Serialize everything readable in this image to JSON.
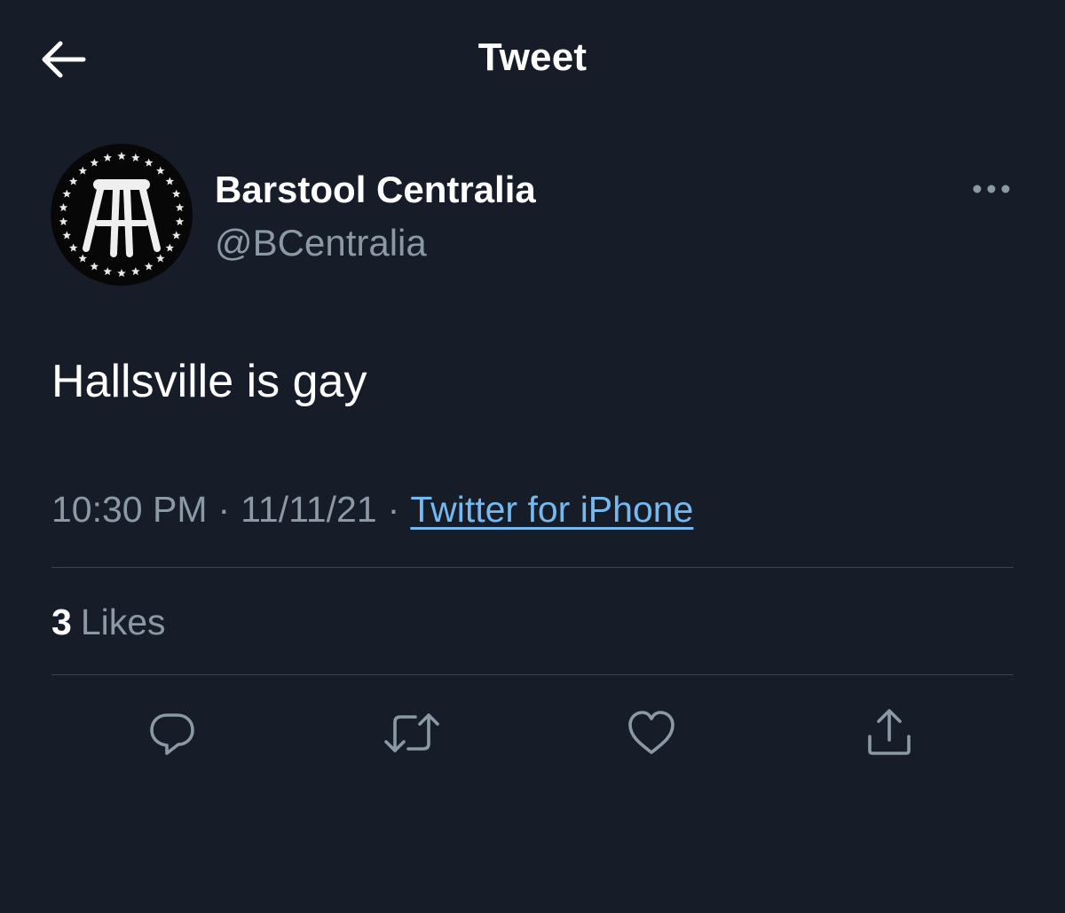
{
  "header": {
    "title": "Tweet",
    "back_icon": "arrow-left-icon"
  },
  "tweet": {
    "author": {
      "display_name": "Barstool Centralia",
      "handle": "@BCentralia",
      "avatar_icon": "barstool-logo"
    },
    "more_icon": "more-horizontal-icon",
    "text": "Hallsville is gay",
    "time": "10:30 PM",
    "separator": "·",
    "date": "11/11/21",
    "source": "Twitter for iPhone",
    "stats": {
      "likes_count": "3",
      "likes_label": "Likes"
    },
    "actions": [
      {
        "icon": "reply-icon"
      },
      {
        "icon": "retweet-icon"
      },
      {
        "icon": "like-icon"
      },
      {
        "icon": "share-icon"
      }
    ]
  },
  "colors": {
    "background": "#161d28",
    "primary_text": "#ffffff",
    "secondary_text": "#8b98a5",
    "link": "#75b9ef",
    "divider": "#38444d"
  }
}
